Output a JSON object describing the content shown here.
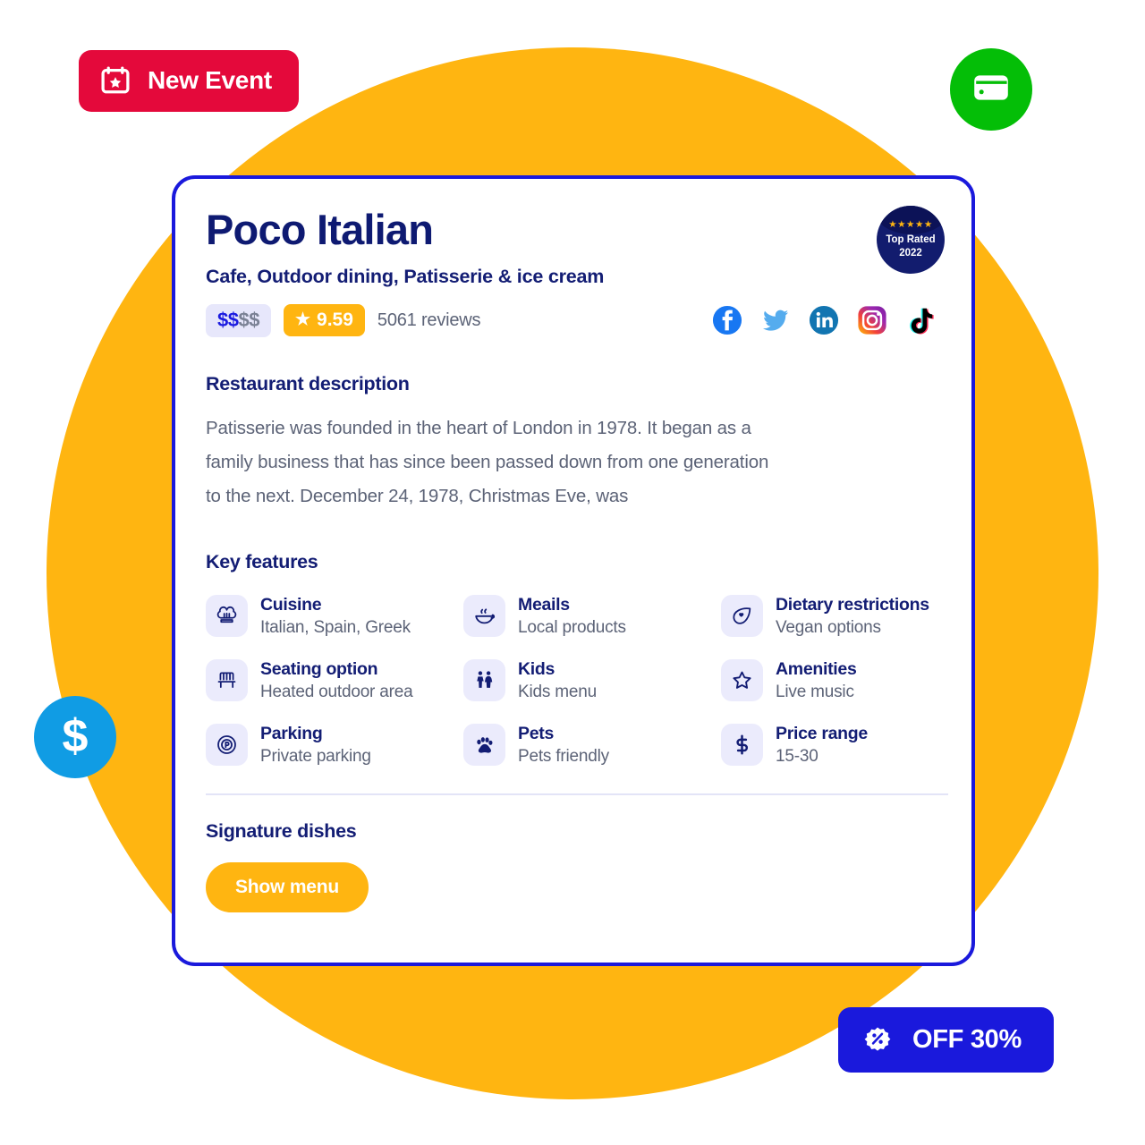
{
  "background": {
    "circle_color": "#FFB511",
    "page_color": "#ffffff"
  },
  "chips": {
    "new_event": {
      "label": "New Event",
      "icon": "calendar-star-icon",
      "color": "#E4093B"
    },
    "off": {
      "label": "OFF 30%",
      "icon": "percent-badge-icon",
      "color": "#1A19DC"
    },
    "wallet_fab": {
      "icon": "wallet-icon",
      "color": "#04BE07"
    },
    "dollar_fab": {
      "icon": "dollar-icon",
      "glyph": "$",
      "color": "#109CE4"
    }
  },
  "card": {
    "border_color": "#1A19DC",
    "title": "Poco Italian",
    "subtitle": "Cafe, Outdoor dining, Patisserie & ice cream",
    "rating": {
      "price_level_on": "$$",
      "price_level_off": "$$",
      "star_glyph": "★",
      "score": "9.59",
      "reviews": "5061 reviews"
    },
    "top_rated_badge": {
      "stars": "★★★★★",
      "line1": "Top Rated",
      "line2": "2022"
    },
    "socials": [
      {
        "name": "facebook-icon"
      },
      {
        "name": "twitter-icon"
      },
      {
        "name": "linkedin-icon"
      },
      {
        "name": "instagram-icon"
      },
      {
        "name": "tiktok-icon"
      }
    ],
    "description": {
      "heading": "Restaurant description",
      "body": "Patisserie was founded in the heart of London in 1978. It began as a family business that has since been passed down from one generation to the next. December 24, 1978, Christmas Eve, was"
    },
    "key_features": {
      "heading": "Key features",
      "items": [
        {
          "icon": "chef-hat-icon",
          "label": "Cuisine",
          "value": "Italian, Spain, Greek"
        },
        {
          "icon": "soup-bowl-icon",
          "label": "Meails",
          "value": "Local products"
        },
        {
          "icon": "leaf-heart-icon",
          "label": "Dietary restrictions",
          "value": "Vegan options"
        },
        {
          "icon": "bench-icon",
          "label": "Seating option",
          "value": "Heated outdoor area"
        },
        {
          "icon": "kids-icon",
          "label": "Kids",
          "value": "Kids menu"
        },
        {
          "icon": "star-outline-icon",
          "label": "Amenities",
          "value": "Live music"
        },
        {
          "icon": "parking-icon",
          "label": "Parking",
          "value": "Private parking"
        },
        {
          "icon": "paw-icon",
          "label": "Pets",
          "value": "Pets friendly"
        },
        {
          "icon": "dollar-sign-icon",
          "label": "Price range",
          "value": "15-30"
        }
      ]
    },
    "signature_dishes": {
      "heading": "Signature dishes",
      "button_label": "Show menu"
    }
  }
}
